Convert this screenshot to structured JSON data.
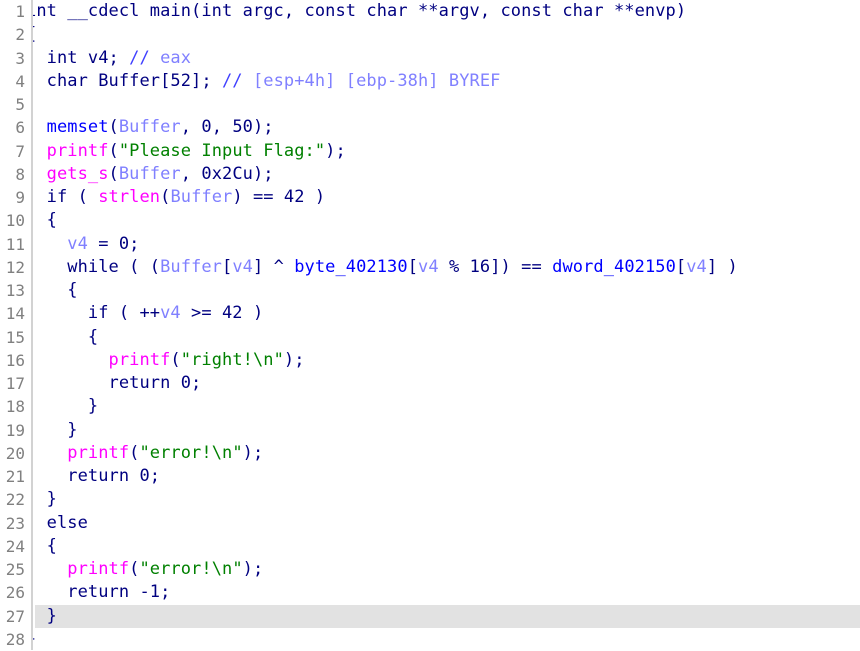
{
  "view": {
    "name": "pseudocode-view",
    "background": "#ffffff",
    "gutter_color": "#808080",
    "current_line_highlight": "#e2e2e2",
    "current_line": 27,
    "total_lines": 28
  },
  "palette": {
    "keyword": "#000080",
    "function": "#ff00ff",
    "global": "#0000ff",
    "variable": "#8080ff",
    "string": "#008000",
    "comment": "#8080ff",
    "comment_slash": "#4040ff",
    "line_number": "#808080"
  },
  "lines": [
    {
      "num": "1",
      "tokens": [
        {
          "t": "int __cdecl main(int argc, const char **argv, const char **envp)",
          "c": "t-kw"
        }
      ]
    },
    {
      "num": "2",
      "tokens": [
        {
          "t": "{",
          "c": "t-kw"
        }
      ]
    },
    {
      "num": "3",
      "tokens": [
        {
          "t": "  int v4; ",
          "c": "t-kw"
        },
        {
          "t": "//",
          "c": "t-cmt"
        },
        {
          "t": " eax",
          "c": "t-cmt2"
        }
      ]
    },
    {
      "num": "4",
      "tokens": [
        {
          "t": "  char Buffer[52]; ",
          "c": "t-kw"
        },
        {
          "t": "//",
          "c": "t-cmt"
        },
        {
          "t": " [esp+4h] [ebp-38h] BYREF",
          "c": "t-cmt2"
        }
      ]
    },
    {
      "num": "5",
      "tokens": [
        {
          "t": "",
          "c": "t-kw"
        }
      ]
    },
    {
      "num": "6",
      "tokens": [
        {
          "t": "  ",
          "c": "t-kw"
        },
        {
          "t": "memset",
          "c": "t-glob"
        },
        {
          "t": "(",
          "c": "t-punct"
        },
        {
          "t": "Buffer",
          "c": "t-var"
        },
        {
          "t": ", 0, 50);",
          "c": "t-kw"
        }
      ]
    },
    {
      "num": "7",
      "tokens": [
        {
          "t": "  ",
          "c": "t-kw"
        },
        {
          "t": "printf",
          "c": "t-fn"
        },
        {
          "t": "(",
          "c": "t-punct"
        },
        {
          "t": "\"Please Input Flag:\"",
          "c": "t-str"
        },
        {
          "t": ");",
          "c": "t-kw"
        }
      ]
    },
    {
      "num": "8",
      "tokens": [
        {
          "t": "  ",
          "c": "t-kw"
        },
        {
          "t": "gets_s",
          "c": "t-fn"
        },
        {
          "t": "(",
          "c": "t-punct"
        },
        {
          "t": "Buffer",
          "c": "t-var"
        },
        {
          "t": ", 0x2Cu);",
          "c": "t-kw"
        }
      ]
    },
    {
      "num": "9",
      "tokens": [
        {
          "t": "  if ( ",
          "c": "t-kw"
        },
        {
          "t": "strlen",
          "c": "t-fn"
        },
        {
          "t": "(",
          "c": "t-punct"
        },
        {
          "t": "Buffer",
          "c": "t-var"
        },
        {
          "t": ") == 42 )",
          "c": "t-kw"
        }
      ]
    },
    {
      "num": "10",
      "tokens": [
        {
          "t": "  {",
          "c": "t-kw"
        }
      ]
    },
    {
      "num": "11",
      "tokens": [
        {
          "t": "    ",
          "c": "t-kw"
        },
        {
          "t": "v4",
          "c": "t-var"
        },
        {
          "t": " = 0;",
          "c": "t-kw"
        }
      ]
    },
    {
      "num": "12",
      "tokens": [
        {
          "t": "    while ( (",
          "c": "t-kw"
        },
        {
          "t": "Buffer",
          "c": "t-var"
        },
        {
          "t": "[",
          "c": "t-punct"
        },
        {
          "t": "v4",
          "c": "t-var"
        },
        {
          "t": "] ^ ",
          "c": "t-kw"
        },
        {
          "t": "byte_402130",
          "c": "t-glob"
        },
        {
          "t": "[",
          "c": "t-punct"
        },
        {
          "t": "v4",
          "c": "t-var"
        },
        {
          "t": " % 16]) == ",
          "c": "t-kw"
        },
        {
          "t": "dword_402150",
          "c": "t-glob"
        },
        {
          "t": "[",
          "c": "t-punct"
        },
        {
          "t": "v4",
          "c": "t-var"
        },
        {
          "t": "] )",
          "c": "t-kw"
        }
      ]
    },
    {
      "num": "13",
      "tokens": [
        {
          "t": "    {",
          "c": "t-kw"
        }
      ]
    },
    {
      "num": "14",
      "tokens": [
        {
          "t": "      if ( ++",
          "c": "t-kw"
        },
        {
          "t": "v4",
          "c": "t-var"
        },
        {
          "t": " >= 42 )",
          "c": "t-kw"
        }
      ]
    },
    {
      "num": "15",
      "tokens": [
        {
          "t": "      {",
          "c": "t-kw"
        }
      ]
    },
    {
      "num": "16",
      "tokens": [
        {
          "t": "        ",
          "c": "t-kw"
        },
        {
          "t": "printf",
          "c": "t-fn"
        },
        {
          "t": "(",
          "c": "t-punct"
        },
        {
          "t": "\"right!\\n\"",
          "c": "t-str"
        },
        {
          "t": ");",
          "c": "t-kw"
        }
      ]
    },
    {
      "num": "17",
      "tokens": [
        {
          "t": "        return 0;",
          "c": "t-kw"
        }
      ]
    },
    {
      "num": "18",
      "tokens": [
        {
          "t": "      }",
          "c": "t-kw"
        }
      ]
    },
    {
      "num": "19",
      "tokens": [
        {
          "t": "    }",
          "c": "t-kw"
        }
      ]
    },
    {
      "num": "20",
      "tokens": [
        {
          "t": "    ",
          "c": "t-kw"
        },
        {
          "t": "printf",
          "c": "t-fn"
        },
        {
          "t": "(",
          "c": "t-punct"
        },
        {
          "t": "\"error!\\n\"",
          "c": "t-str"
        },
        {
          "t": ");",
          "c": "t-kw"
        }
      ]
    },
    {
      "num": "21",
      "tokens": [
        {
          "t": "    return 0;",
          "c": "t-kw"
        }
      ]
    },
    {
      "num": "22",
      "tokens": [
        {
          "t": "  }",
          "c": "t-kw"
        }
      ]
    },
    {
      "num": "23",
      "tokens": [
        {
          "t": "  else",
          "c": "t-kw"
        }
      ]
    },
    {
      "num": "24",
      "tokens": [
        {
          "t": "  {",
          "c": "t-kw"
        }
      ]
    },
    {
      "num": "25",
      "tokens": [
        {
          "t": "    ",
          "c": "t-kw"
        },
        {
          "t": "printf",
          "c": "t-fn"
        },
        {
          "t": "(",
          "c": "t-punct"
        },
        {
          "t": "\"error!\\n\"",
          "c": "t-str"
        },
        {
          "t": ");",
          "c": "t-kw"
        }
      ]
    },
    {
      "num": "26",
      "tokens": [
        {
          "t": "    return -1;",
          "c": "t-kw"
        }
      ]
    },
    {
      "num": "27",
      "tokens": [
        {
          "t": "  }",
          "c": "t-kw"
        }
      ],
      "current": true
    },
    {
      "num": "28",
      "tokens": [
        {
          "t": "}",
          "c": "t-kw"
        }
      ]
    }
  ]
}
